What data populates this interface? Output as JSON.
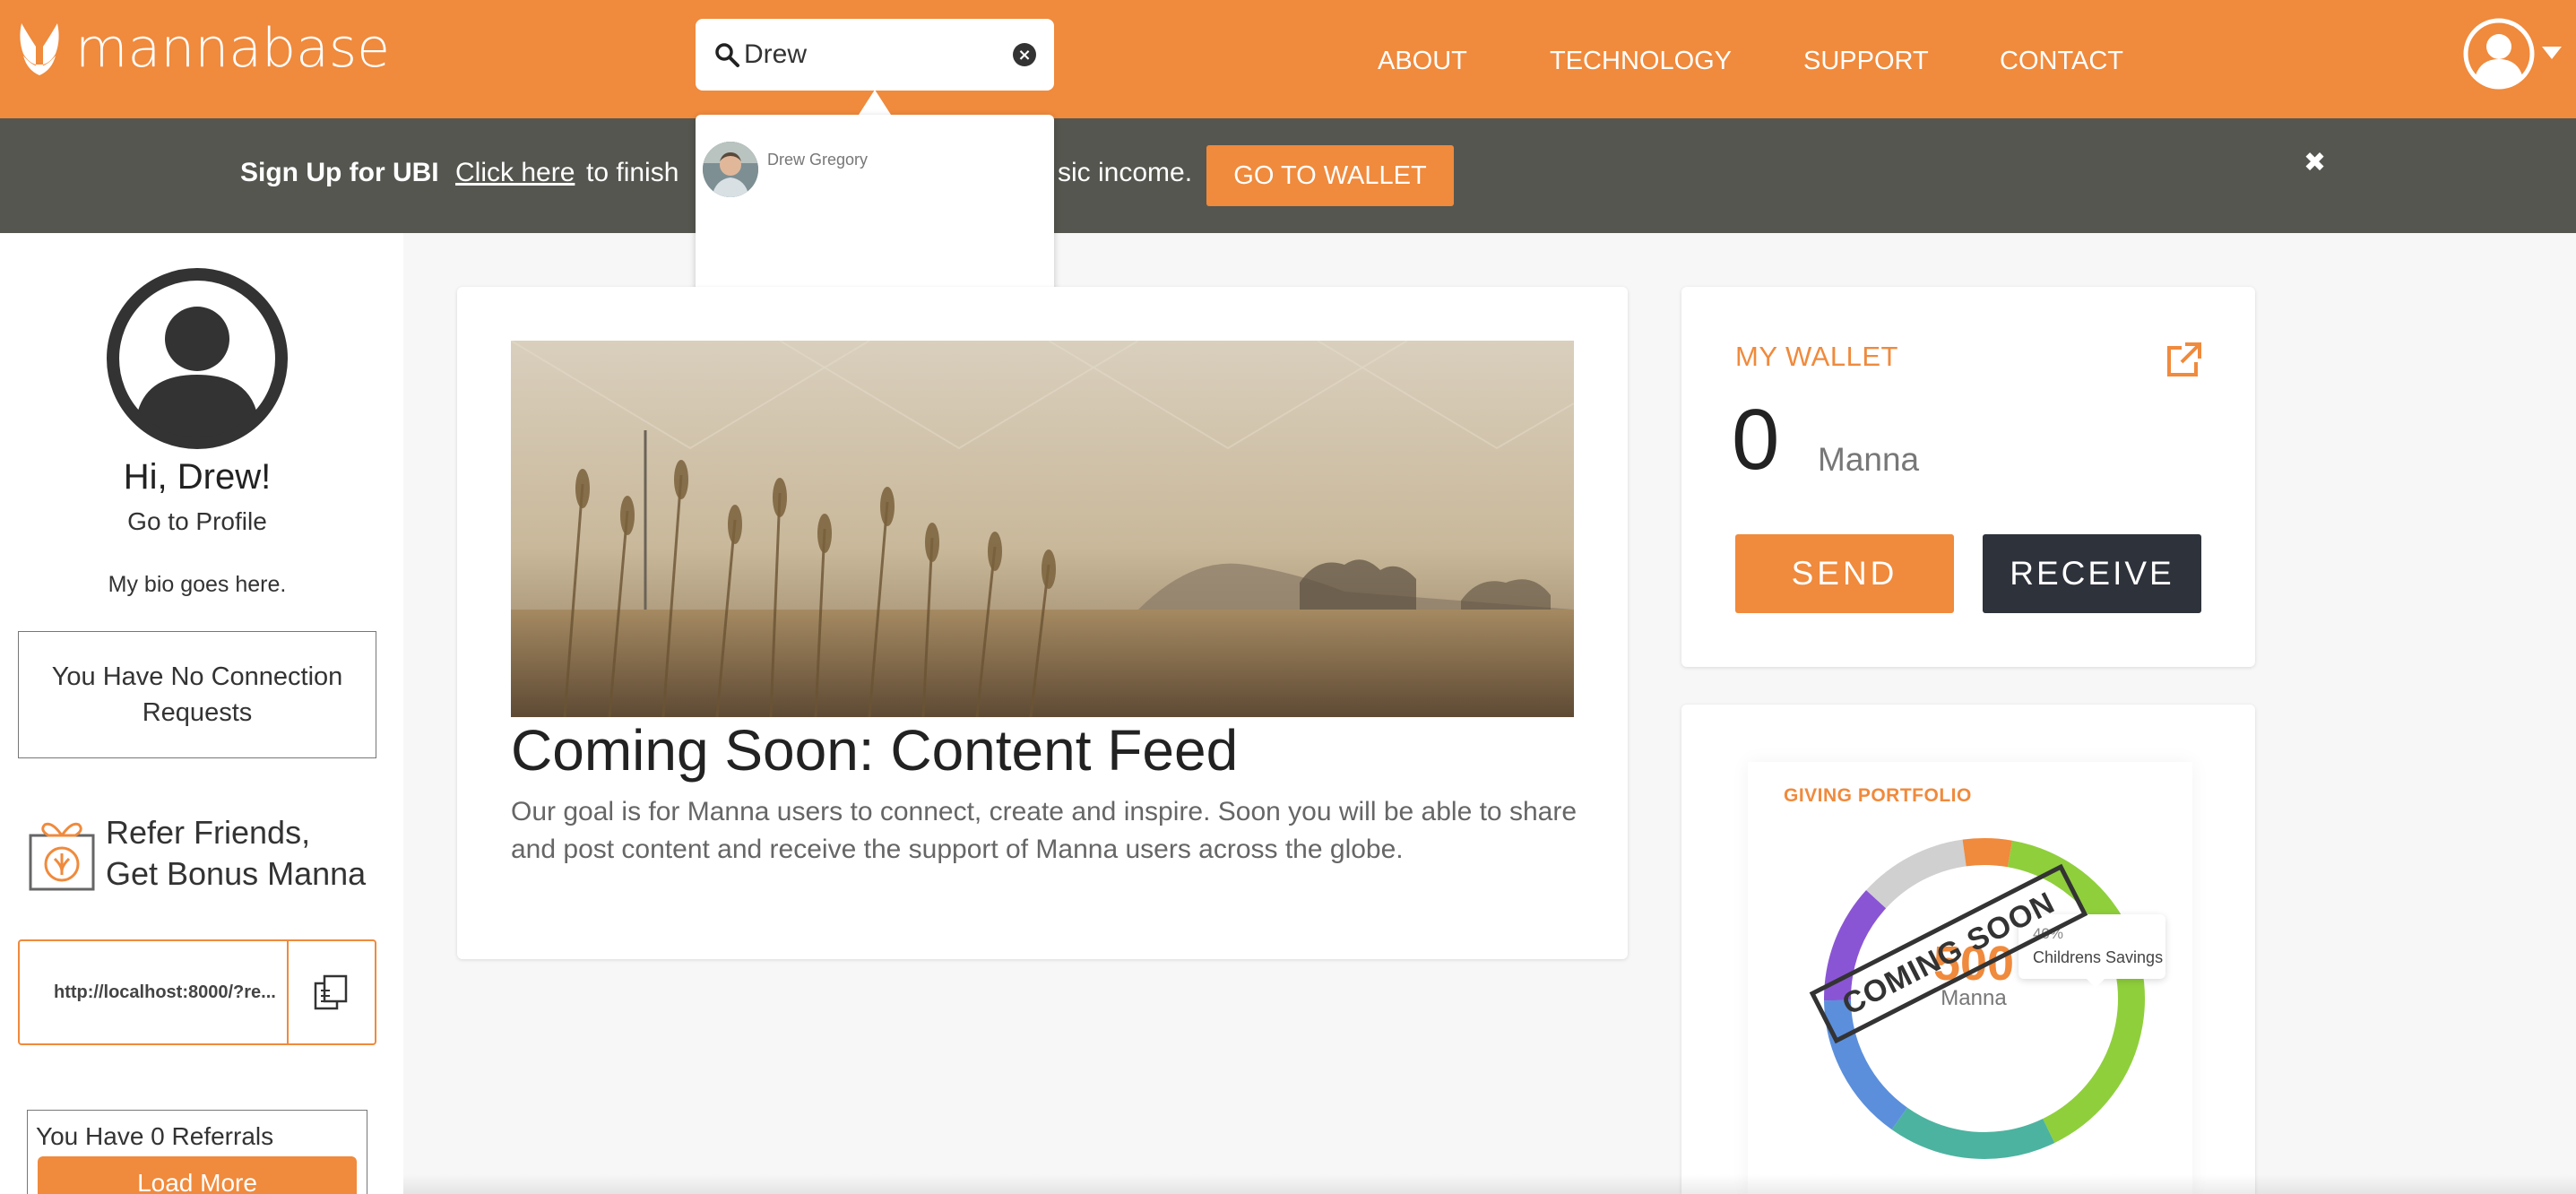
{
  "header": {
    "logo_text": "mannabase",
    "search_value": "Drew",
    "nav": [
      "ABOUT",
      "TECHNOLOGY",
      "SUPPORT",
      "CONTACT"
    ]
  },
  "search_dropdown": {
    "results": [
      {
        "name": "Drew Gregory"
      }
    ]
  },
  "banner": {
    "strong": "Sign Up for UBI",
    "link": "Click here",
    "text": "to finish",
    "text_tail": "sic income.",
    "button": "GO TO WALLET",
    "close": "✖"
  },
  "sidebar": {
    "greeting": "Hi, Drew!",
    "profile_link": "Go to Profile",
    "bio": "My bio goes here.",
    "connection_requests": "You Have No Connection Requests",
    "refer_line1": "Refer Friends,",
    "refer_line2": "Get Bonus Manna",
    "referral_url": "http://localhost:8000/?re...",
    "referrals_count_text": "You Have 0 Referrals",
    "load_more": "Load More"
  },
  "feed": {
    "title": "Coming Soon: Content Feed",
    "body": "Our goal is for Manna users to connect, create and inspire. Soon you will be able to share and post content and receive the support of Manna users across the globe."
  },
  "wallet": {
    "title": "MY WALLET",
    "balance": "0",
    "unit": "Manna",
    "send": "SEND",
    "receive": "RECEIVE"
  },
  "giving": {
    "title": "GIVING PORTFOLIO",
    "total": "500",
    "unit": "Manna",
    "stamp": "COMING SOON",
    "tooltip_pct": "40%",
    "tooltip_label": "Childrens Savings",
    "segments": [
      {
        "color": "#8fcf3c",
        "fraction": 0.4
      },
      {
        "color": "#4cb3a0",
        "fraction": 0.17
      },
      {
        "color": "#5b8fdc",
        "fraction": 0.15
      },
      {
        "color": "#8a55d4",
        "fraction": 0.12
      },
      {
        "color": "#d0d0d0",
        "fraction": 0.11
      },
      {
        "color": "#f08a3c",
        "fraction": 0.05
      }
    ]
  },
  "colors": {
    "accent": "#f08a3c",
    "banner": "#55564f",
    "dark_button": "#2e323b"
  }
}
